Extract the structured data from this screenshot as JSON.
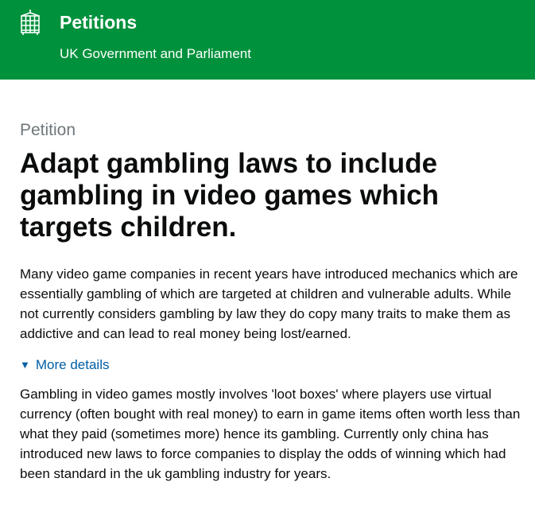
{
  "header": {
    "crest_icon": "portcullis-icon",
    "title": "Petitions",
    "subtitle": "UK Government and Parliament",
    "background": "#00913c"
  },
  "petition": {
    "label": "Petition",
    "title": "Adapt gambling laws to include gambling in video games which targets children.",
    "summary": "Many video game companies in recent years have introduced mechanics which are essentially gambling of which are targeted at children and vulnerable adults. While not currently considers gambling by law they do copy many traits to make them as addictive and can lead to real money being lost/earned.",
    "details_toggle": {
      "icon": "triangle-down-icon",
      "arrow": "▼",
      "label": "More details"
    },
    "details": "Gambling in video games mostly involves 'loot boxes' where players use virtual currency (often bought with real money) to earn in game items often worth less than what they paid (sometimes more) hence its gambling. Currently only china has introduced new laws to force companies to display the odds of winning which had been standard in the uk gambling industry for years."
  }
}
